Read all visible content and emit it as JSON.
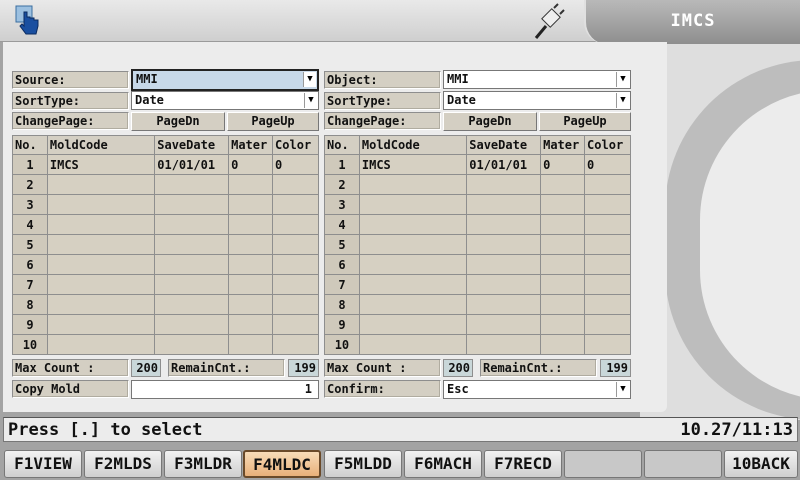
{
  "header": {
    "title": "IMCS",
    "left_icon": "hand-pointer-icon",
    "status_icon": "plug-icon"
  },
  "source": {
    "source_label": "Source:",
    "source_value": "MMI",
    "sort_label": "SortType:",
    "sort_value": "Date",
    "page_label": "ChangePage:",
    "page_dn": "PageDn",
    "page_up": "PageUp",
    "columns": [
      "No.",
      "MoldCode",
      "SaveDate",
      "Mater",
      "Color"
    ],
    "rows": [
      [
        "1",
        "IMCS",
        "01/01/01",
        "0",
        "0"
      ],
      [
        "2",
        "",
        "",
        "",
        ""
      ],
      [
        "3",
        "",
        "",
        "",
        ""
      ],
      [
        "4",
        "",
        "",
        "",
        ""
      ],
      [
        "5",
        "",
        "",
        "",
        ""
      ],
      [
        "6",
        "",
        "",
        "",
        ""
      ],
      [
        "7",
        "",
        "",
        "",
        ""
      ],
      [
        "8",
        "",
        "",
        "",
        ""
      ],
      [
        "9",
        "",
        "",
        "",
        ""
      ],
      [
        "10",
        "",
        "",
        "",
        ""
      ]
    ],
    "max_label": "Max Count :",
    "max_value": "200",
    "remain_label": "RemainCnt.:",
    "remain_value": "199",
    "copy_label": "Copy Mold",
    "copy_value": "1"
  },
  "object": {
    "object_label": "Object:",
    "object_value": "MMI",
    "sort_label": "SortType:",
    "sort_value": "Date",
    "page_label": "ChangePage:",
    "page_dn": "PageDn",
    "page_up": "PageUp",
    "columns": [
      "No.",
      "MoldCode",
      "SaveDate",
      "Mater",
      "Color"
    ],
    "rows": [
      [
        "1",
        "IMCS",
        "01/01/01",
        "0",
        "0"
      ],
      [
        "2",
        "",
        "",
        "",
        ""
      ],
      [
        "3",
        "",
        "",
        "",
        ""
      ],
      [
        "4",
        "",
        "",
        "",
        ""
      ],
      [
        "5",
        "",
        "",
        "",
        ""
      ],
      [
        "6",
        "",
        "",
        "",
        ""
      ],
      [
        "7",
        "",
        "",
        "",
        ""
      ],
      [
        "8",
        "",
        "",
        "",
        ""
      ],
      [
        "9",
        "",
        "",
        "",
        ""
      ],
      [
        "10",
        "",
        "",
        "",
        ""
      ]
    ],
    "max_label": "Max Count :",
    "max_value": "200",
    "remain_label": "RemainCnt.:",
    "remain_value": "199",
    "confirm_label": "Confirm:",
    "confirm_value": "Esc"
  },
  "status": {
    "message": "Press [.] to select",
    "time": "10.27/11:13"
  },
  "fkeys": [
    "F1VIEW",
    "F2MLDS",
    "F3MLDR",
    "F4MLDC",
    "F5MLDD",
    "F6MACH",
    "F7RECD",
    "",
    "",
    "10BACK"
  ],
  "colors": {
    "active_key": "#e8b07a",
    "cell": "#d6d0c2",
    "selected_field": "#c7d8e8"
  }
}
